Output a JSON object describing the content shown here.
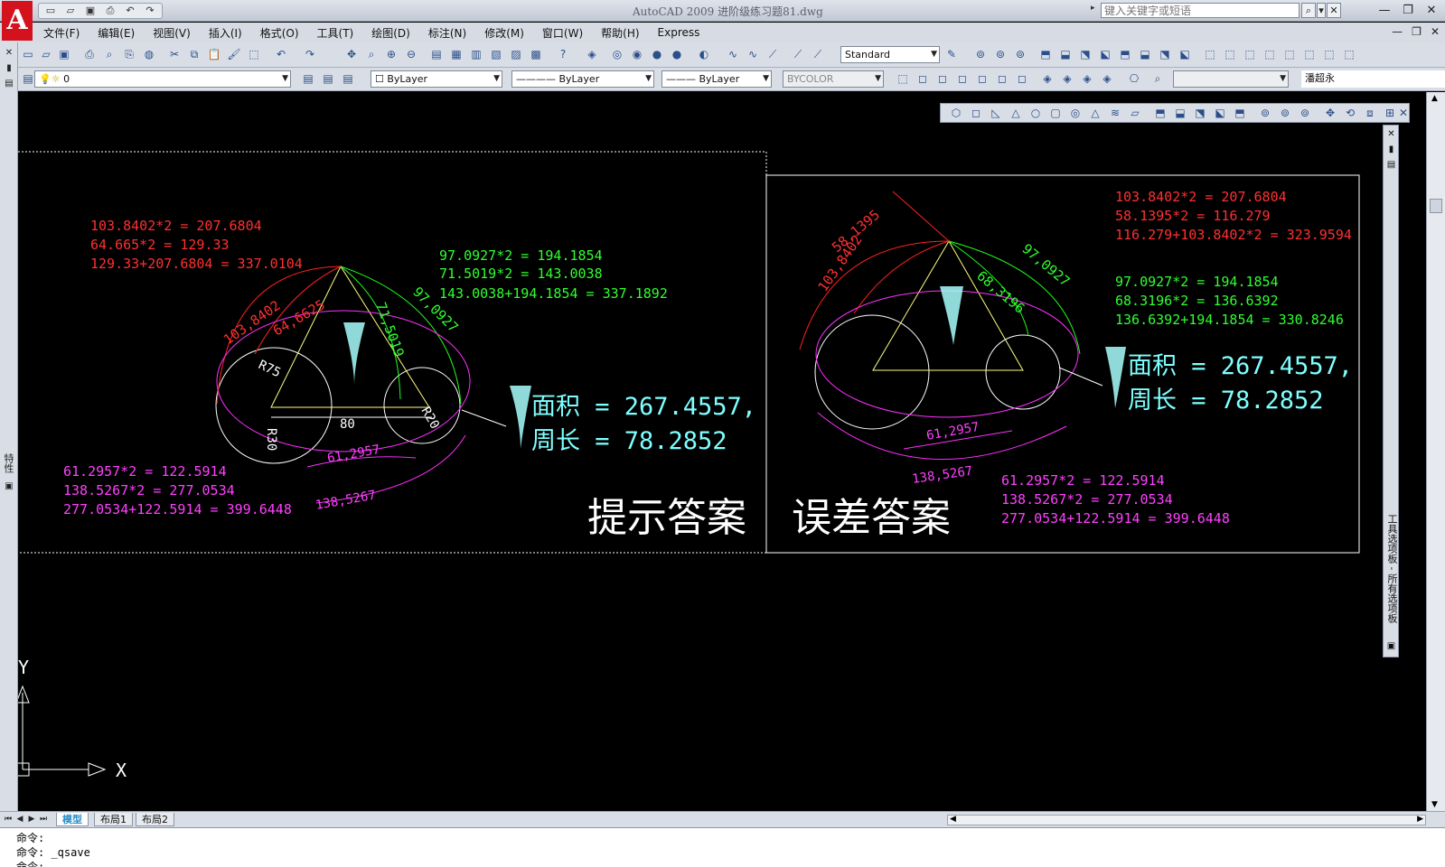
{
  "window": {
    "title": "AutoCAD 2009 进阶级练习题81.dwg",
    "search_placeholder": "键入关键字或短语"
  },
  "quick_access": [
    "new-icon",
    "open-icon",
    "save-icon",
    "print-icon",
    "undo-icon",
    "redo-icon"
  ],
  "menu": {
    "items": [
      "文件(F)",
      "编辑(E)",
      "视图(V)",
      "插入(I)",
      "格式(O)",
      "工具(T)",
      "绘图(D)",
      "标注(N)",
      "修改(M)",
      "窗口(W)",
      "帮助(H)",
      "Express"
    ]
  },
  "toolbar": {
    "text_style": "Standard",
    "layer": "0",
    "color": "ByLayer",
    "linetype": "ByLayer",
    "lineweight": "ByLayer",
    "plot_style": "BYCOLOR",
    "user": "潘超永"
  },
  "left_strip_label": "特性",
  "palette_label": "工具选项板 - 所有选项板",
  "drawing": {
    "left_panel": {
      "red_lines": [
        "103.8402*2 = 207.6804",
        "64.665*2 = 129.33",
        "129.33+207.6804 = 337.0104"
      ],
      "green_lines": [
        "97.0927*2 = 194.1854",
        "71.5019*2 = 143.0038",
        "143.0038+194.1854 = 337.1892"
      ],
      "magenta_lines": [
        "61.2957*2 = 122.5914",
        "138.5267*2 = 277.0534",
        "277.0534+122.5914 = 399.6448"
      ],
      "dims": {
        "arc_red_outer": "103,8402",
        "arc_red_inner": "64,6625",
        "arc_green_inner": "71,5019",
        "arc_green_outer": "97,0927",
        "radius_large": "R75",
        "width": "80",
        "radius_right": "R20",
        "radius_bottom": "R30",
        "arc_magenta_inner": "61,2957",
        "arc_magenta_outer": "138,5267"
      },
      "area_label": "面积 = 267.4557,",
      "perimeter_label": "周长 = 78.2852",
      "caption": "提示答案"
    },
    "right_panel": {
      "red_lines": [
        "103.8402*2 = 207.6804",
        "58.1395*2 = 116.279",
        "116.279+103.8402*2 = 323.9594"
      ],
      "green_lines": [
        "97.0927*2 = 194.1854",
        "68.3196*2 = 136.6392",
        "136.6392+194.1854 = 330.8246"
      ],
      "magenta_lines": [
        "61.2957*2 = 122.5914",
        "138.5267*2 = 277.0534",
        "277.0534+122.5914 = 399.6448"
      ],
      "dims": {
        "arc_red_inner": "58,1395",
        "arc_red_outer": "103,8402",
        "arc_green_inner": "68,3196",
        "arc_green_outer": "97,0927",
        "arc_magenta_inner": "61,2957",
        "arc_magenta_outer": "138,5267"
      },
      "area_label": "面积 = 267.4557,",
      "perimeter_label": "周长 = 78.2852",
      "caption": "误差答案"
    },
    "ucs": {
      "x": "X",
      "y": "Y"
    }
  },
  "layout_tabs": [
    "模型",
    "布局1",
    "布局2"
  ],
  "command_line": {
    "line1": "命令:",
    "line2": "命令: _qsave",
    "line3": "命令:"
  }
}
